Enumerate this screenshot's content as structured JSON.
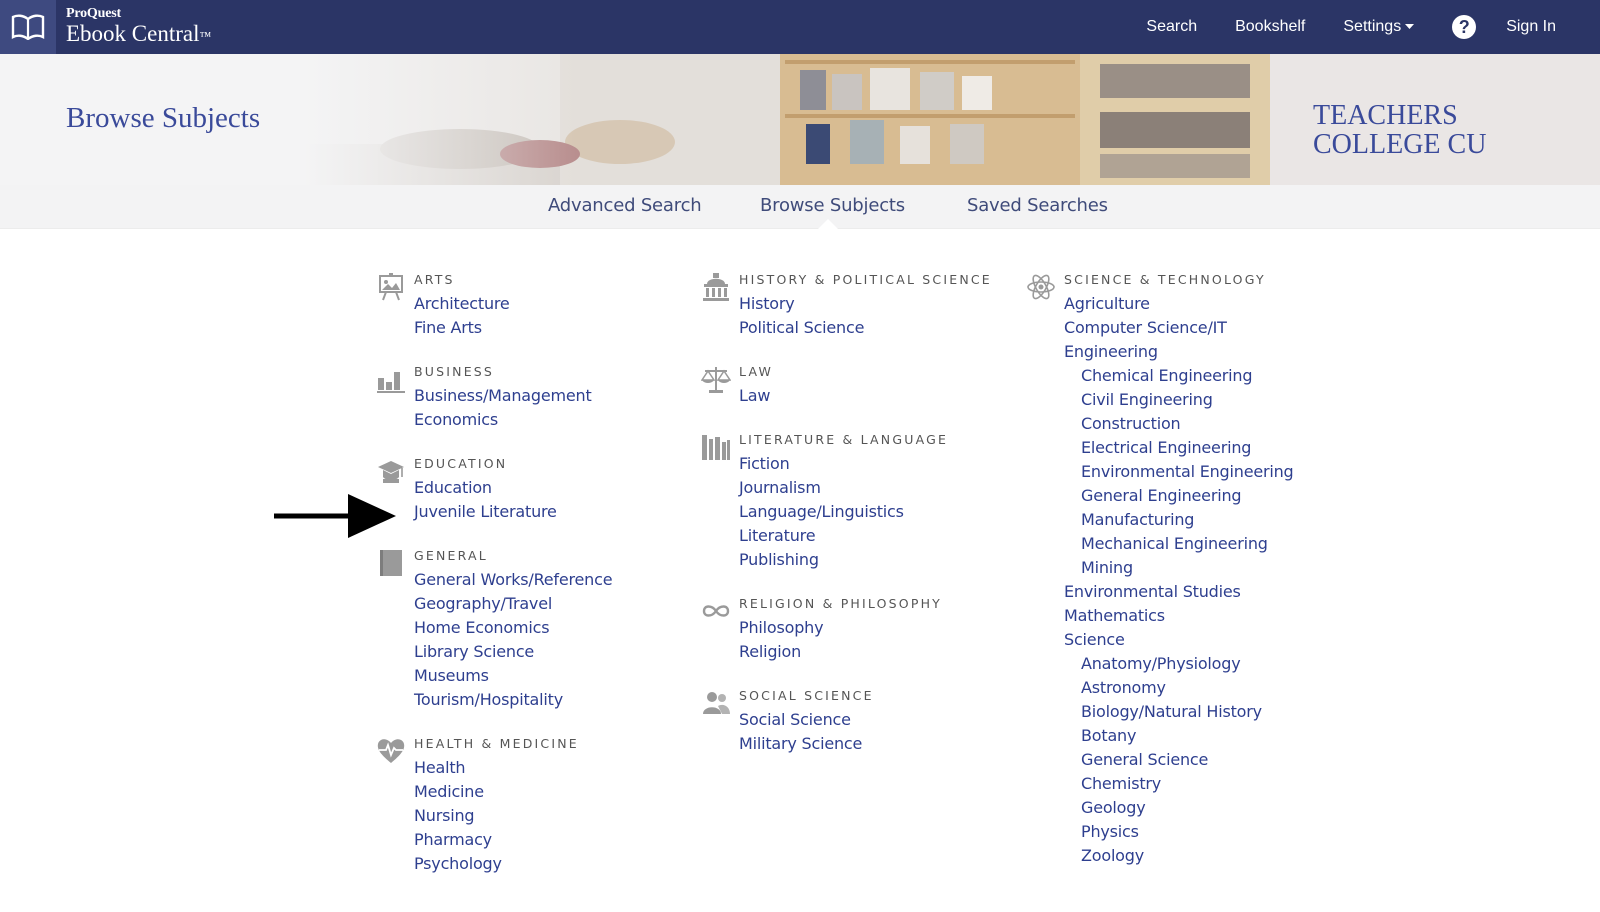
{
  "topbar": {
    "brand_small": "ProQuest",
    "brand_big": "Ebook Central",
    "brand_mark": "™",
    "nav": [
      "Search",
      "Bookshelf",
      "Settings"
    ],
    "help_label": "?",
    "signin": "Sign In"
  },
  "hero": {
    "title": "Browse Subjects",
    "institution_line1": "TEACHERS",
    "institution_line2": "COLLEGE CU"
  },
  "subnav": {
    "items": [
      "Advanced Search",
      "Browse Subjects",
      "Saved Searches"
    ],
    "active": "Browse Subjects"
  },
  "columns": [
    [
      {
        "icon": "easel-icon",
        "heading": "ARTS",
        "items": [
          {
            "label": "Architecture"
          },
          {
            "label": "Fine Arts"
          }
        ]
      },
      {
        "icon": "bar-chart-icon",
        "heading": "BUSINESS",
        "items": [
          {
            "label": "Business/Management"
          },
          {
            "label": "Economics"
          }
        ]
      },
      {
        "icon": "graduation-cap-icon",
        "heading": "EDUCATION",
        "items": [
          {
            "label": "Education"
          },
          {
            "label": "Juvenile Literature"
          }
        ]
      },
      {
        "icon": "book-icon",
        "heading": "GENERAL",
        "items": [
          {
            "label": "General Works/Reference"
          },
          {
            "label": "Geography/Travel"
          },
          {
            "label": "Home Economics"
          },
          {
            "label": "Library Science"
          },
          {
            "label": "Museums"
          },
          {
            "label": "Tourism/Hospitality"
          }
        ]
      },
      {
        "icon": "heart-pulse-icon",
        "heading": "HEALTH & MEDICINE",
        "items": [
          {
            "label": "Health"
          },
          {
            "label": "Medicine"
          },
          {
            "label": "Nursing"
          },
          {
            "label": "Pharmacy"
          },
          {
            "label": "Psychology"
          }
        ]
      }
    ],
    [
      {
        "icon": "capitol-building-icon",
        "heading": "HISTORY & POLITICAL SCIENCE",
        "items": [
          {
            "label": "History"
          },
          {
            "label": "Political Science"
          }
        ]
      },
      {
        "icon": "scales-icon",
        "heading": "LAW",
        "items": [
          {
            "label": "Law"
          }
        ]
      },
      {
        "icon": "books-icon",
        "heading": "LITERATURE & LANGUAGE",
        "items": [
          {
            "label": "Fiction"
          },
          {
            "label": "Journalism"
          },
          {
            "label": "Language/Linguistics"
          },
          {
            "label": "Literature"
          },
          {
            "label": "Publishing"
          }
        ]
      },
      {
        "icon": "infinity-icon",
        "heading": "RELIGION & PHILOSOPHY",
        "items": [
          {
            "label": "Philosophy"
          },
          {
            "label": "Religion"
          }
        ]
      },
      {
        "icon": "people-icon",
        "heading": "SOCIAL SCIENCE",
        "items": [
          {
            "label": "Social Science"
          },
          {
            "label": "Military Science"
          }
        ]
      }
    ],
    [
      {
        "icon": "atom-icon",
        "heading": "SCIENCE & TECHNOLOGY",
        "items": [
          {
            "label": "Agriculture"
          },
          {
            "label": "Computer Science/IT"
          },
          {
            "label": "Engineering"
          },
          {
            "label": "Chemical Engineering",
            "indent": true
          },
          {
            "label": "Civil Engineering",
            "indent": true
          },
          {
            "label": "Construction",
            "indent": true
          },
          {
            "label": "Electrical Engineering",
            "indent": true
          },
          {
            "label": "Environmental Engineering",
            "indent": true
          },
          {
            "label": "General Engineering",
            "indent": true
          },
          {
            "label": "Manufacturing",
            "indent": true
          },
          {
            "label": "Mechanical Engineering",
            "indent": true
          },
          {
            "label": "Mining",
            "indent": true
          },
          {
            "label": "Environmental Studies"
          },
          {
            "label": "Mathematics"
          },
          {
            "label": "Science"
          },
          {
            "label": "Anatomy/Physiology",
            "indent": true
          },
          {
            "label": "Astronomy",
            "indent": true
          },
          {
            "label": "Biology/Natural History",
            "indent": true
          },
          {
            "label": "Botany",
            "indent": true
          },
          {
            "label": "General Science",
            "indent": true
          },
          {
            "label": "Chemistry",
            "indent": true
          },
          {
            "label": "Geology",
            "indent": true
          },
          {
            "label": "Physics",
            "indent": true
          },
          {
            "label": "Zoology",
            "indent": true
          }
        ]
      }
    ]
  ],
  "colors": {
    "topbar": "#2b3566",
    "link": "#2e3f8f",
    "title": "#3a4a9a",
    "icon_gray": "#9a9a9a"
  }
}
